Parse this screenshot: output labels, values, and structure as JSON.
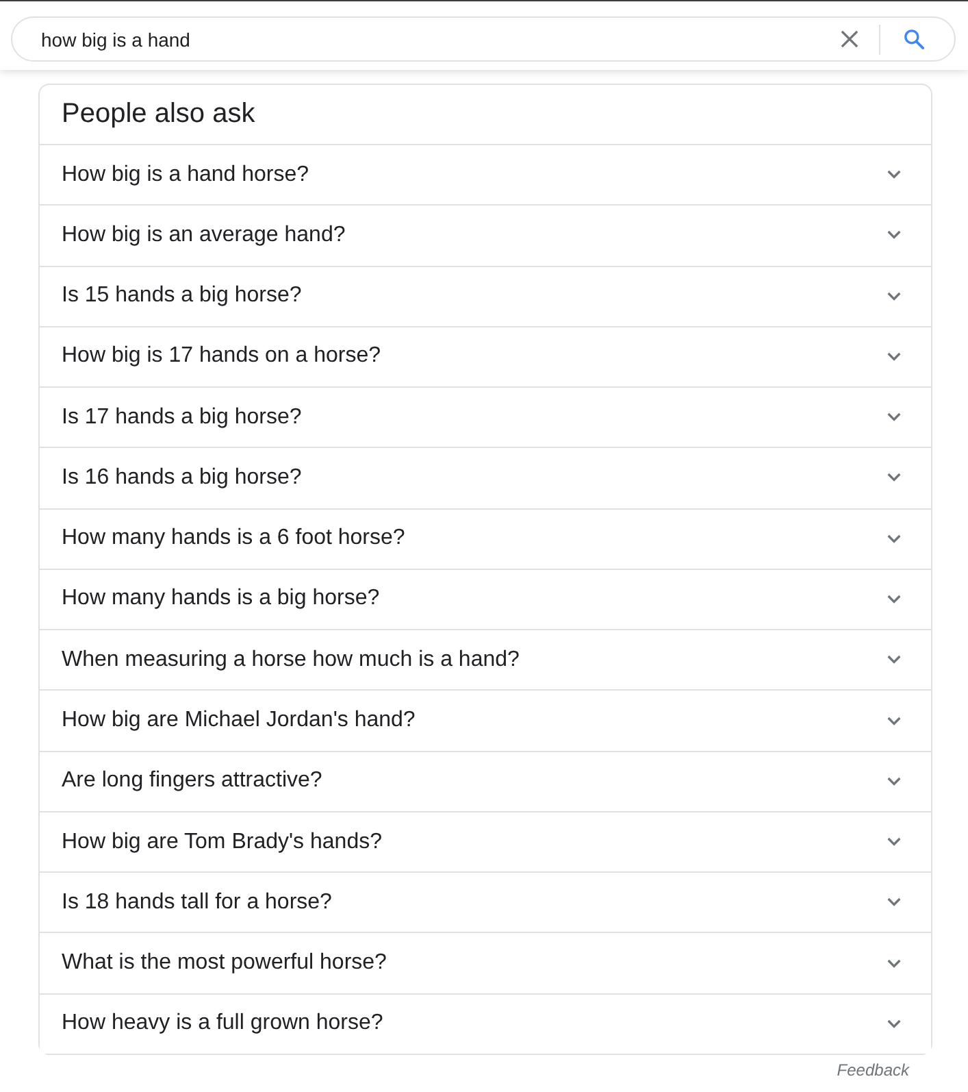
{
  "search": {
    "value": "how big is a hand"
  },
  "people_also_ask": {
    "title": "People also ask",
    "questions": [
      {
        "text": "How big is a hand horse?",
        "expanded": false
      },
      {
        "text": "How big is an average hand?",
        "expanded": false
      },
      {
        "text": "Is 15 hands a big horse?",
        "expanded": false
      },
      {
        "text": "How big is 17 hands on a horse?",
        "expanded": false
      },
      {
        "text": "Is 17 hands a big horse?",
        "expanded": false
      },
      {
        "text": "Is 16 hands a big horse?",
        "expanded": false
      },
      {
        "text": "How many hands is a 6 foot horse?",
        "expanded": false
      },
      {
        "text": "How many hands is a big horse?",
        "expanded": false
      },
      {
        "text": "When measuring a horse how much is a hand?",
        "expanded": false
      },
      {
        "text": "How big are Michael Jordan's hand?",
        "expanded": false
      },
      {
        "text": "Are long fingers attractive?",
        "expanded": false
      },
      {
        "text": "How big are Tom Brady's hands?",
        "expanded": false
      },
      {
        "text": "Is 18 hands tall for a horse?",
        "expanded": false
      },
      {
        "text": "What is the most powerful horse?",
        "expanded": false
      },
      {
        "text": "How heavy is a full grown horse?",
        "expanded": false
      }
    ]
  },
  "feedback": "Feedback"
}
